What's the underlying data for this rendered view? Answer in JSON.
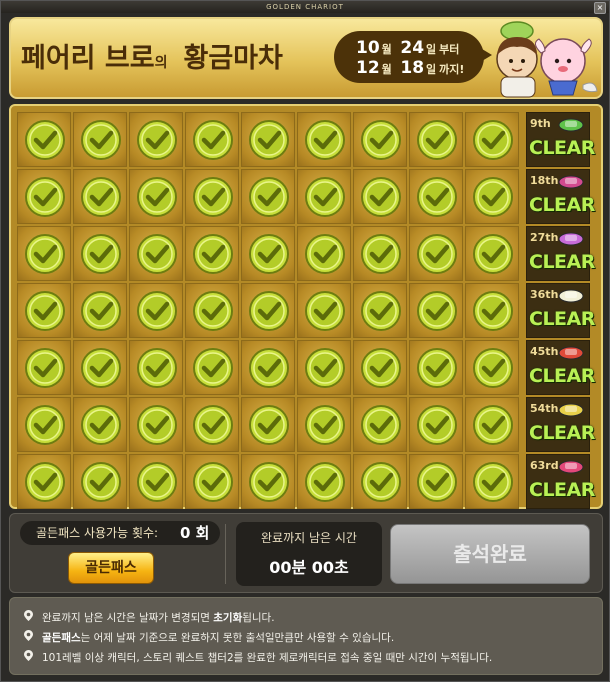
{
  "window": {
    "title": "GOLDEN CHARIOT",
    "close_label": "×"
  },
  "header": {
    "title_part1": "페어리 브로",
    "title_particle": "의",
    "title_part2": "황금마차",
    "date_start_month": "10",
    "date_start_day": "24",
    "date_end_month": "12",
    "date_end_day": "18",
    "month_unit": "월",
    "day_unit": "일",
    "from_text": "부터",
    "until_text": "까지!"
  },
  "board": {
    "rows": [
      {
        "day_label": "9th",
        "clear_label": "CLEAR",
        "gift_color": "#5fc24a"
      },
      {
        "day_label": "18th",
        "clear_label": "CLEAR",
        "gift_color": "#d24a8f"
      },
      {
        "day_label": "27th",
        "clear_label": "CLEAR",
        "gift_color": "#c86bd8"
      },
      {
        "day_label": "36th",
        "clear_label": "CLEAR",
        "gift_color": "#f2f0d8"
      },
      {
        "day_label": "45th",
        "clear_label": "CLEAR",
        "gift_color": "#e04a3a"
      },
      {
        "day_label": "54th",
        "clear_label": "CLEAR",
        "gift_color": "#e8d04a"
      },
      {
        "day_label": "63rd",
        "clear_label": "CLEAR",
        "gift_color": "#e2487a"
      }
    ],
    "columns_per_row": 9,
    "check_icon": "check-circle-icon"
  },
  "golden_pass": {
    "label": "골든패스 사용가능 횟수:",
    "count": "0 회",
    "button_label": "골든패스"
  },
  "timer": {
    "caption": "완료까지 남은 시간",
    "value": "00분 00초"
  },
  "complete_button_label": "출석완료",
  "notes": [
    {
      "prefix": "",
      "bold": "",
      "mid": "완료까지 남은 시간은 날짜가 변경되면 ",
      "bold2": "초기화",
      "suffix": "됩니다."
    },
    {
      "prefix": "",
      "bold": "골든패스",
      "mid": "는 어제 날짜 기준으로 완료하지 못한 출석일만큼만 사용할 수 있습니다.",
      "bold2": "",
      "suffix": ""
    },
    {
      "prefix": "101레벨 이상 캐릭터, 스토리 퀘스트 챕터2를 완료한 제로캐릭터로 접속 중일 때만 시간이 누적됩니다.",
      "bold": "",
      "mid": "",
      "bold2": "",
      "suffix": ""
    }
  ]
}
